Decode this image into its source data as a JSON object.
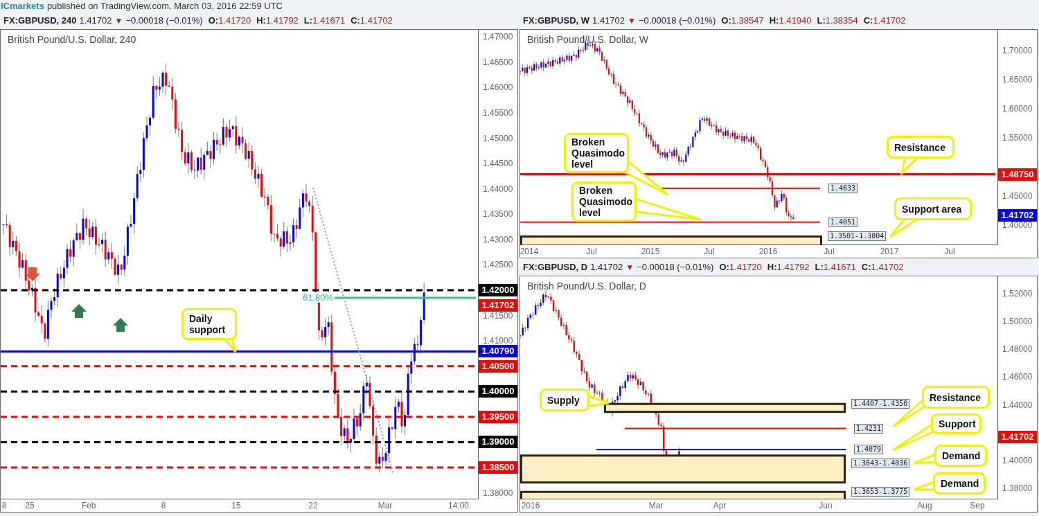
{
  "byline": {
    "author": "ICmarkets",
    "text": "published on TradingView.com, March 03, 2016 22:59 UTC"
  },
  "charts": [
    {
      "legend": {
        "symbol": "FX:GBPUSD, 240",
        "last": "1.41702",
        "arrow": "▼",
        "change": "−0.00018 (−0.01%)",
        "ohlc": [
          {
            "key": "O:",
            "value": "1.41720"
          },
          {
            "key": "H:",
            "value": "1.41792"
          },
          {
            "key": "L:",
            "value": "1.41671"
          },
          {
            "key": "C:",
            "value": "1.41702"
          }
        ]
      },
      "title": "British Pound/U.S. Dollar, 240",
      "yticks": [
        "1.47000",
        "1.46500",
        "1.46000",
        "1.45500",
        "1.45000",
        "1.44500",
        "1.44000",
        "1.43500",
        "1.43000",
        "1.42500",
        "1.41500",
        "1.41000",
        "1.38000"
      ],
      "xticks": [
        "8",
        "25",
        "Feb",
        "8",
        "15",
        "22",
        "Mar",
        "14:00"
      ],
      "lines": [
        {
          "price": "1.42000",
          "kind": "dashed",
          "color": "#000000"
        },
        {
          "price": "1.41702",
          "kind": "tag",
          "color": "#ff0000"
        },
        {
          "price": "1.40790",
          "kind": "solid",
          "color": "#0000ff"
        },
        {
          "price": "1.40500",
          "kind": "dashed",
          "color": "#ff0000"
        },
        {
          "price": "1.40000",
          "kind": "dashed",
          "color": "#000000"
        },
        {
          "price": "1.39500",
          "kind": "dashed",
          "color": "#ff0000"
        },
        {
          "price": "1.39000",
          "kind": "dashed",
          "color": "#000000"
        },
        {
          "price": "1.38500",
          "kind": "dashed",
          "color": "#ff0000"
        }
      ],
      "fib": {
        "label": "61.80%",
        "color": "#2ec28f"
      },
      "trendline": true,
      "markers": [
        {
          "kind": "down"
        },
        {
          "kind": "up"
        },
        {
          "kind": "up"
        }
      ],
      "callouts": [
        {
          "text": "Daily support"
        }
      ]
    },
    {
      "legend": {
        "symbol": "FX:GBPUSD, W",
        "last": "1.41702",
        "arrow": "▼",
        "change": "−0.00018 (−0.01%)",
        "ohlc": [
          {
            "key": "O:",
            "value": "1.38547"
          },
          {
            "key": "H:",
            "value": "1.41940"
          },
          {
            "key": "L:",
            "value": "1.38354"
          },
          {
            "key": "C:",
            "value": "1.41702"
          }
        ]
      },
      "title": "British Pound/U.S. Dollar, W",
      "yticks": [
        "1.70000",
        "1.65000",
        "1.60000",
        "1.55000",
        "1.45000",
        "1.40000"
      ],
      "xticks": [
        "2014",
        "Jul",
        "2015",
        "Jul",
        "2016",
        "Jul",
        "2017",
        "Jul"
      ],
      "lines": [
        {
          "price": "1.48750",
          "kind": "solid",
          "color": "#ff0000"
        },
        {
          "price": "1.4633",
          "kind": "thin",
          "color": "#ff0000"
        },
        {
          "price": "1.4051",
          "kind": "thin",
          "color": "#ff0000"
        },
        {
          "price": "1.41702",
          "kind": "tag",
          "color": "#0000ff"
        }
      ],
      "zones": [
        {
          "label": "1.3501-1.3804"
        }
      ],
      "callouts": [
        {
          "text": "Broken Quasimodo level"
        },
        {
          "text": "Broken Quasimodo level"
        },
        {
          "text": "Resistance"
        },
        {
          "text": "Support area"
        }
      ]
    },
    {
      "legend": {
        "symbol": "FX:GBPUSD, D",
        "last": "1.41702",
        "arrow": "▼",
        "change": "−0.00018 (−0.01%)",
        "ohlc": [
          {
            "key": "O:",
            "value": "1.41720"
          },
          {
            "key": "H:",
            "value": "1.41792"
          },
          {
            "key": "L:",
            "value": "1.41671"
          },
          {
            "key": "C:",
            "value": "1.41702"
          }
        ]
      },
      "title": "British Pound/U.S. Dollar, D",
      "yticks": [
        "1.52000",
        "1.50000",
        "1.48000",
        "1.46000",
        "1.44000",
        "1.40000",
        "1.38000"
      ],
      "xticks": [
        "2016",
        "Mar",
        "Apr",
        "Jun",
        "Aug",
        "Sep"
      ],
      "lines": [
        {
          "price": "1.4231",
          "kind": "thin",
          "color": "#ff0000"
        },
        {
          "price": "1.4079",
          "kind": "thin",
          "color": "#0000ff"
        },
        {
          "price": "1.41702",
          "kind": "tag",
          "color": "#ff0000"
        }
      ],
      "zones": [
        {
          "label": "1.4407-1.4350"
        },
        {
          "label": "1.3843-1.4036"
        },
        {
          "label": "1.3653-1.3775"
        }
      ],
      "callouts": [
        {
          "text": "Supply"
        },
        {
          "text": "Resistance"
        },
        {
          "text": "Support"
        },
        {
          "text": "Demand"
        },
        {
          "text": "Demand"
        }
      ]
    }
  ]
}
